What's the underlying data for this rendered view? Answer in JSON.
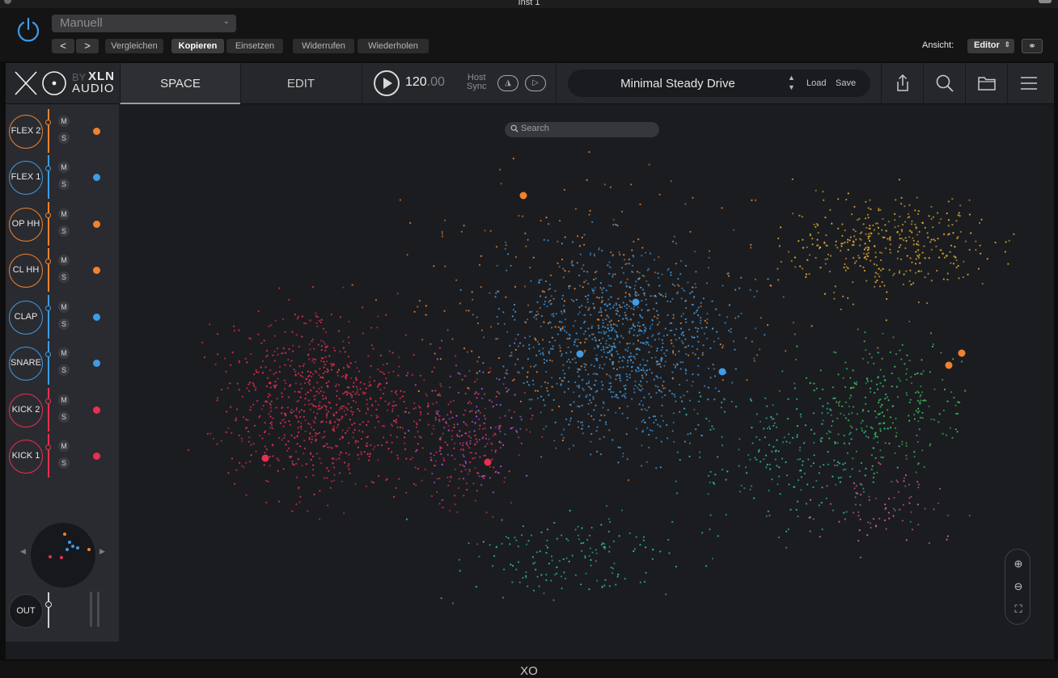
{
  "window": {
    "title": "Inst 1",
    "footer_title": "XO"
  },
  "host": {
    "preset_value": "Manuell",
    "nav_back": "<",
    "nav_forward": ">",
    "buttons": [
      "Vergleichen",
      "Kopieren",
      "Einsetzen",
      "Widerrufen",
      "Wiederholen"
    ],
    "view_label": "Ansicht:",
    "view_value": "Editor"
  },
  "plugin": {
    "logo": {
      "main": "XO",
      "by": "BY",
      "brand_top": "XLN",
      "brand_bottom": "AUDIO"
    },
    "tabs": [
      "SPACE",
      "EDIT"
    ],
    "active_tab": "SPACE",
    "tempo": {
      "whole": "120",
      "decimals": ".00"
    },
    "host_sync": {
      "line1": "Host",
      "line2": "Sync"
    },
    "preset": {
      "name": "Minimal Steady Drive",
      "load": "Load",
      "save": "Save"
    },
    "slots": [
      {
        "name": "FLEX 2",
        "color": "#f0822f",
        "mute": "M",
        "solo": "S"
      },
      {
        "name": "FLEX 1",
        "color": "#3e9be6",
        "mute": "M",
        "solo": "S"
      },
      {
        "name": "OP HH",
        "color": "#f0822f",
        "mute": "M",
        "solo": "S"
      },
      {
        "name": "CL HH",
        "color": "#f0822f",
        "mute": "M",
        "solo": "S"
      },
      {
        "name": "CLAP",
        "color": "#3e9be6",
        "mute": "M",
        "solo": "S"
      },
      {
        "name": "SNARE",
        "color": "#3e9be6",
        "mute": "M",
        "solo": "S"
      },
      {
        "name": "KICK 2",
        "color": "#e8304f",
        "mute": "M",
        "solo": "S"
      },
      {
        "name": "KICK 1",
        "color": "#e8304f",
        "mute": "M",
        "solo": "S"
      }
    ],
    "output_label": "OUT",
    "search_placeholder": "Search",
    "colors": {
      "kick": "#e8304f",
      "snare": "#3e9be6",
      "hihat": "#f0822f",
      "perc": "#e6b233",
      "tom": "#3cc45a",
      "cymbal": "#27c2b4",
      "fx": "#b454e6",
      "clap": "#e05aa8"
    }
  }
}
